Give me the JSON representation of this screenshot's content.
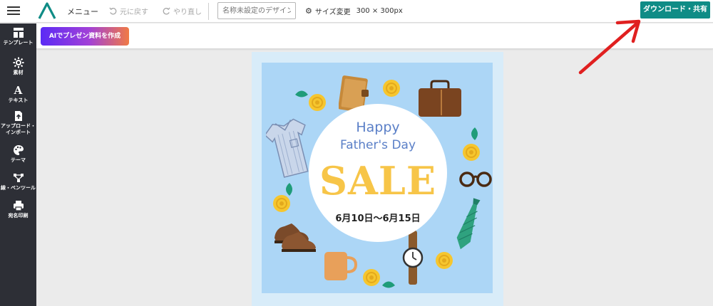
{
  "toolbar": {
    "menu_label": "メニュー",
    "undo_label": "元に戻す",
    "redo_label": "やり直し",
    "document_name_placeholder": "名称未設定のデザイン",
    "resize_label": "サイズ変更",
    "canvas_size": "300 × 300px",
    "download_label": "ダウンロード・共有"
  },
  "subbar": {
    "ai_button_label": "AIでプレゼン資料を作成"
  },
  "sidebar": {
    "items": [
      {
        "label": "テンプレート",
        "icon": "template-icon"
      },
      {
        "label": "素材",
        "icon": "material-icon"
      },
      {
        "label": "テキスト",
        "icon": "text-icon"
      },
      {
        "label": "アップロード・",
        "label2": "インポート",
        "icon": "upload-icon"
      },
      {
        "label": "テーマ",
        "icon": "palette-icon"
      },
      {
        "label": "線・ペンツール",
        "icon": "pen-tool-icon"
      },
      {
        "label": "宛名印刷",
        "icon": "printer-icon"
      }
    ]
  },
  "canvas": {
    "happy": "Happy",
    "fathers_day": "Father's Day",
    "sale": "SALE",
    "dates": "6月10日〜6月15日"
  },
  "colors": {
    "accent": "#0f8c86",
    "sidebar_bg": "#2d2f36",
    "canvas_bg": "#acd6f6",
    "sale_yellow": "#f7c548",
    "title_blue": "#5a7fc7",
    "annotation_red": "#e02020"
  }
}
